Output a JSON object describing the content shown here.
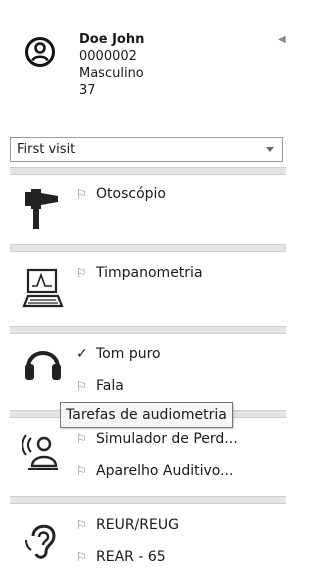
{
  "patient": {
    "name": "Doe John",
    "id": "0000002",
    "gender": "Masculino",
    "age": "37",
    "avatar_icon": "user-circle-icon"
  },
  "visit": {
    "selected": "First visit"
  },
  "groups": [
    {
      "icon": "otoscope-icon",
      "items": [
        {
          "label": "Otoscópio",
          "mark": "flag"
        }
      ]
    },
    {
      "icon": "tympanometry-icon",
      "items": [
        {
          "label": "Timpanometria",
          "mark": "flag"
        }
      ]
    },
    {
      "icon": "headphones-icon",
      "items": [
        {
          "label": "Tom puro",
          "mark": "check"
        },
        {
          "label": "Fala",
          "mark": "flag"
        }
      ]
    },
    {
      "icon": "speech-simulator-icon",
      "items": [
        {
          "label": "Simulador de Perd...",
          "mark": "flag"
        },
        {
          "label": "Aparelho Auditivo...",
          "mark": "flag"
        }
      ]
    },
    {
      "icon": "ear-icon",
      "items": [
        {
          "label": "REUR/REUG",
          "mark": "flag"
        },
        {
          "label": "REAR - 65",
          "mark": "flag"
        }
      ]
    }
  ],
  "tooltip": "Tarefas de audiometria"
}
